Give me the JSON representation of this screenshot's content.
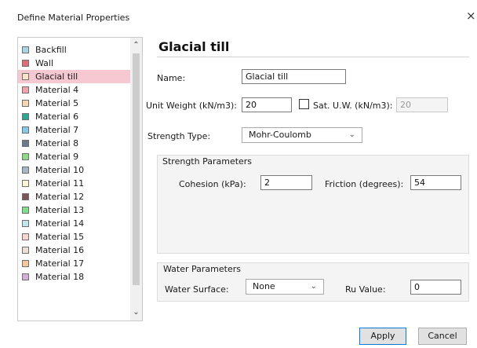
{
  "window": {
    "title": "Define Material Properties",
    "close_glyph": "×"
  },
  "materials": [
    {
      "label": "Backfill",
      "color": "#a9d4e6"
    },
    {
      "label": "Wall",
      "color": "#e06b78"
    },
    {
      "label": "Glacial till",
      "color": "#fbe4c8"
    },
    {
      "label": "Material 4",
      "color": "#f2a3ae"
    },
    {
      "label": "Material 5",
      "color": "#f6d8b0"
    },
    {
      "label": "Material 6",
      "color": "#2fa593"
    },
    {
      "label": "Material 7",
      "color": "#86c8e8"
    },
    {
      "label": "Material 8",
      "color": "#6e7a8a"
    },
    {
      "label": "Material 9",
      "color": "#8ed88a"
    },
    {
      "label": "Material 10",
      "color": "#aab6c8"
    },
    {
      "label": "Material 11",
      "color": "#fbf6d6"
    },
    {
      "label": "Material 12",
      "color": "#7a5658"
    },
    {
      "label": "Material 13",
      "color": "#7fe08a"
    },
    {
      "label": "Material 14",
      "color": "#bfe6ea"
    },
    {
      "label": "Material 15",
      "color": "#f7d6d2"
    },
    {
      "label": "Material 16",
      "color": "#eadfd6"
    },
    {
      "label": "Material 17",
      "color": "#f6c79a"
    },
    {
      "label": "Material 18",
      "color": "#d4aed8"
    }
  ],
  "selected_index": 2,
  "selected_color": "#f6c8d2",
  "material": {
    "heading": "Glacial till",
    "name_label": "Name:",
    "name_value": "Glacial till",
    "unit_weight_label": "Unit Weight (kN/m3):",
    "unit_weight_value": "20",
    "sat_checked": false,
    "sat_label": "Sat. U.W. (kN/m3):",
    "sat_value": "20",
    "strength_type_label": "Strength Type:",
    "strength_type_value": "Mohr-Coulomb"
  },
  "strength": {
    "title": "Strength Parameters",
    "cohesion_label": "Cohesion (kPa):",
    "cohesion_value": "2",
    "friction_label": "Friction (degrees):",
    "friction_value": "54"
  },
  "water": {
    "title": "Water Parameters",
    "surface_label": "Water Surface:",
    "surface_value": "None",
    "ru_label": "Ru Value:",
    "ru_value": "0"
  },
  "buttons": {
    "apply": "Apply",
    "cancel": "Cancel"
  },
  "icons": {
    "scroll_up": "chevron-up-icon",
    "scroll_down": "chevron-down-icon",
    "dropdown": "chevron-down-icon",
    "close": "close-icon"
  }
}
